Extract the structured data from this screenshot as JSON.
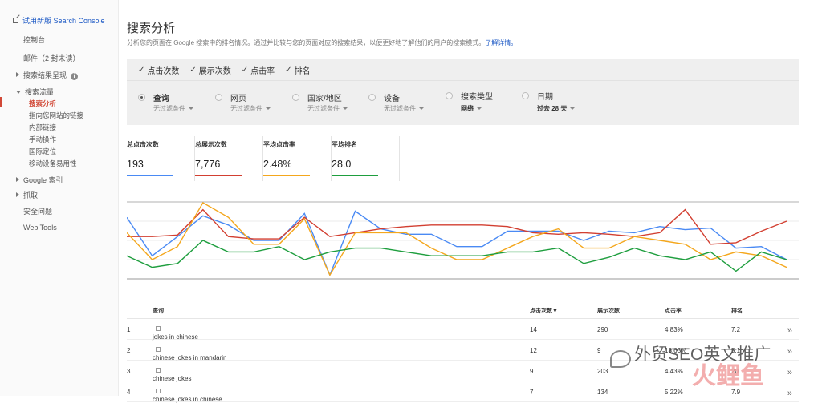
{
  "sidebar": {
    "new_console": "试用新版 Search Console",
    "items": [
      "控制台",
      "邮件（2 封未读）",
      "搜索结果呈现",
      "搜索流量",
      "Google 索引",
      "抓取",
      "安全问题",
      "Web Tools"
    ],
    "sub_items": [
      "搜索分析",
      "指向您网站的链接",
      "内部链接",
      "手动操作",
      "国际定位",
      "移动设备易用性"
    ]
  },
  "page": {
    "title": "搜索分析",
    "description": "分析您的页面在 Google 搜索中的排名情况。通过并比较与您的页面对应的搜索结果，以便更好地了解他们的用户的搜索模式。",
    "learn_more": "了解详情。"
  },
  "checkboxes": [
    "点击次数",
    "展示次数",
    "点击率",
    "排名"
  ],
  "dimensions": [
    {
      "label": "查询",
      "sub": "无过滤条件",
      "selected": true
    },
    {
      "label": "网页",
      "sub": "无过滤条件",
      "selected": false
    },
    {
      "label": "国家/地区",
      "sub": "无过滤条件",
      "selected": false
    },
    {
      "label": "设备",
      "sub": "无过滤条件",
      "selected": false
    },
    {
      "label": "搜索类型",
      "sub": "网络",
      "selected": false
    },
    {
      "label": "日期",
      "sub": "过去 28 天",
      "selected": false
    }
  ],
  "metrics": [
    {
      "label": "总点击次数",
      "value": "193",
      "color": "#4a8af4"
    },
    {
      "label": "总展示次数",
      "value": "7,776",
      "color": "#d23f31"
    },
    {
      "label": "平均点击率",
      "value": "2.48%",
      "color": "#f4a71d"
    },
    {
      "label": "平均排名",
      "value": "28.0",
      "color": "#1e9e3e"
    }
  ],
  "chart_data": {
    "type": "line",
    "x": [
      1,
      2,
      3,
      4,
      5,
      6,
      7,
      8,
      9,
      10,
      11,
      12,
      13,
      14,
      15,
      16,
      17,
      18,
      19,
      20,
      21,
      22,
      23,
      24,
      25,
      26,
      27,
      28
    ],
    "ylim": [
      0,
      100
    ],
    "series": [
      {
        "color": "#4a8af4",
        "values": [
          80,
          30,
          55,
          82,
          70,
          50,
          50,
          85,
          5,
          88,
          65,
          58,
          58,
          42,
          42,
          62,
          62,
          62,
          50,
          62,
          60,
          68,
          64,
          66,
          40,
          42,
          25
        ]
      },
      {
        "color": "#d23f31",
        "values": [
          55,
          55,
          57,
          90,
          55,
          52,
          52,
          80,
          55,
          60,
          65,
          68,
          70,
          70,
          70,
          68,
          60,
          58,
          60,
          58,
          55,
          60,
          90,
          45,
          47,
          62,
          75
        ]
      },
      {
        "color": "#f4a71d",
        "values": [
          60,
          25,
          42,
          99,
          80,
          45,
          45,
          78,
          5,
          60,
          60,
          60,
          40,
          25,
          25,
          40,
          55,
          65,
          40,
          40,
          55,
          50,
          45,
          25,
          35,
          30,
          15
        ]
      },
      {
        "color": "#1e9e3e",
        "values": [
          30,
          15,
          20,
          50,
          35,
          35,
          42,
          25,
          35,
          40,
          40,
          35,
          30,
          30,
          30,
          35,
          35,
          40,
          20,
          28,
          40,
          30,
          25,
          35,
          10,
          35,
          25
        ]
      }
    ]
  },
  "table": {
    "headers": [
      "查询",
      "点击次数▼",
      "展示次数",
      "点击率",
      "排名"
    ],
    "rows": [
      {
        "n": "1",
        "query": "jokes in chinese",
        "clicks": "14",
        "impr": "290",
        "ctr": "4.83%",
        "pos": "7.2"
      },
      {
        "n": "2",
        "query": "chinese jokes in mandarin",
        "clicks": "12",
        "impr": "9",
        "ctr": "13.63%",
        "pos": "5.1"
      },
      {
        "n": "3",
        "query": "chinese jokes",
        "clicks": "9",
        "impr": "203",
        "ctr": "4.43%",
        "pos": "20"
      },
      {
        "n": "4",
        "query": "chinese jokes in chinese",
        "clicks": "7",
        "impr": "134",
        "ctr": "5.22%",
        "pos": "7.9"
      }
    ]
  },
  "watermark": {
    "text": "外贸SEO英文推广",
    "brand": "火鲤鱼"
  }
}
